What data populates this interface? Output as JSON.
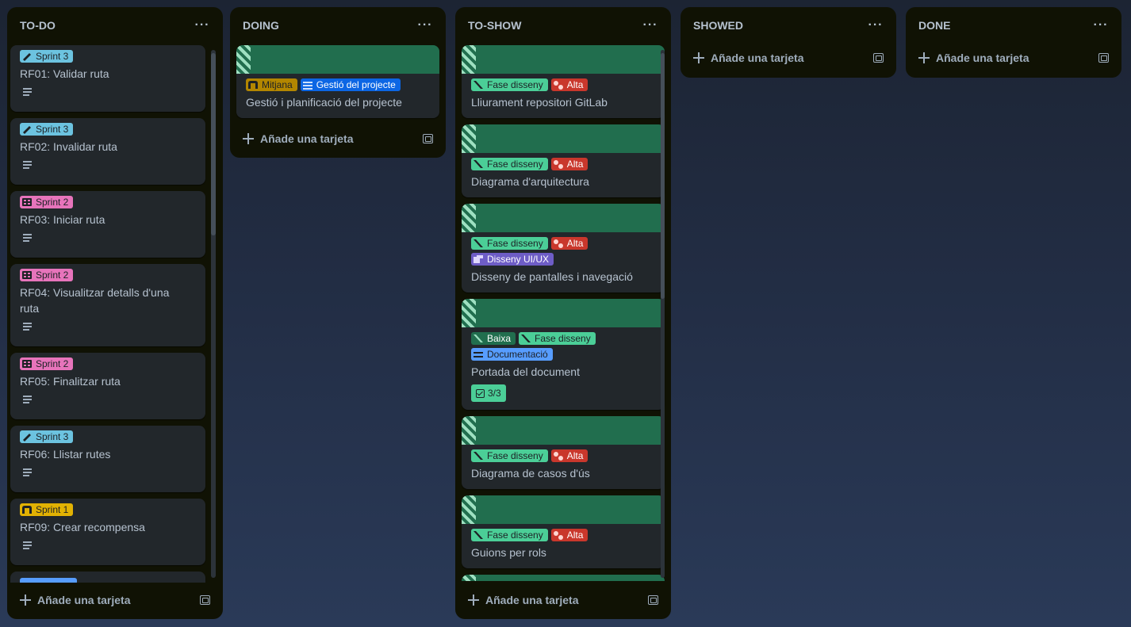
{
  "lists": [
    {
      "title": "TO-DO",
      "cards": [
        {
          "label": "Sprint 3",
          "title": "RF01: Validar ruta"
        },
        {
          "label": "Sprint 3",
          "title": "RF02: Invalidar ruta"
        },
        {
          "label": "Sprint 2",
          "title": "RF03: Iniciar ruta"
        },
        {
          "label": "Sprint 2",
          "title": "RF04: Visualitzar detalls d'una ruta"
        },
        {
          "label": "Sprint 2",
          "title": "RF05: Finalitzar ruta"
        },
        {
          "label": "Sprint 3",
          "title": "RF06: Llistar rutes"
        },
        {
          "label": "Sprint 1",
          "title": "RF09: Crear recompensa"
        }
      ],
      "add_label": "Añade una tarjeta"
    },
    {
      "title": "DOING",
      "cards": [
        {
          "labels": [
            "Mitjana",
            "Gestió del projecte"
          ],
          "title": "Gestió i planificació del projecte"
        }
      ],
      "add_label": "Añade una tarjeta"
    },
    {
      "title": "TO-SHOW",
      "cards": [
        {
          "labels": [
            "Fase disseny",
            "Alta"
          ],
          "title": "Lliurament repositori GitLab"
        },
        {
          "labels": [
            "Fase disseny",
            "Alta"
          ],
          "title": "Diagrama d'arquitectura"
        },
        {
          "labels": [
            "Fase disseny",
            "Alta",
            "Disseny UI/UX"
          ],
          "title": "Disseny de pantalles i navegació"
        },
        {
          "labels": [
            "Baixa",
            "Fase disseny",
            "Documentació"
          ],
          "title": "Portada del document",
          "checklist": "3/3"
        },
        {
          "labels": [
            "Fase disseny",
            "Alta"
          ],
          "title": "Diagrama de casos d'ús"
        },
        {
          "labels": [
            "Fase disseny",
            "Alta"
          ],
          "title": "Guions per rols"
        }
      ],
      "add_label": "Añade una tarjeta"
    },
    {
      "title": "SHOWED",
      "cards": [],
      "add_label": "Añade una tarjeta"
    },
    {
      "title": "DONE",
      "cards": [],
      "add_label": "Añade una tarjeta"
    }
  ],
  "colors": {
    "sprint3": "#6cc3e0",
    "sprint2": "#e774bb",
    "sprint1": "#e2b203",
    "fase_disseny": "#4bce97",
    "alta": "#c9372c",
    "mitjana": "#b38600",
    "gestio": "#0c66e4",
    "ui_ux": "#6e5dc6",
    "baixa": "#216e4e",
    "documentacio": "#579dff",
    "cover": "#216e4e"
  },
  "icons": {
    "list_menu": "ellipsis-icon",
    "add": "plus-icon",
    "template": "card-template-icon",
    "description": "description-icon",
    "checklist": "checklist-icon"
  }
}
